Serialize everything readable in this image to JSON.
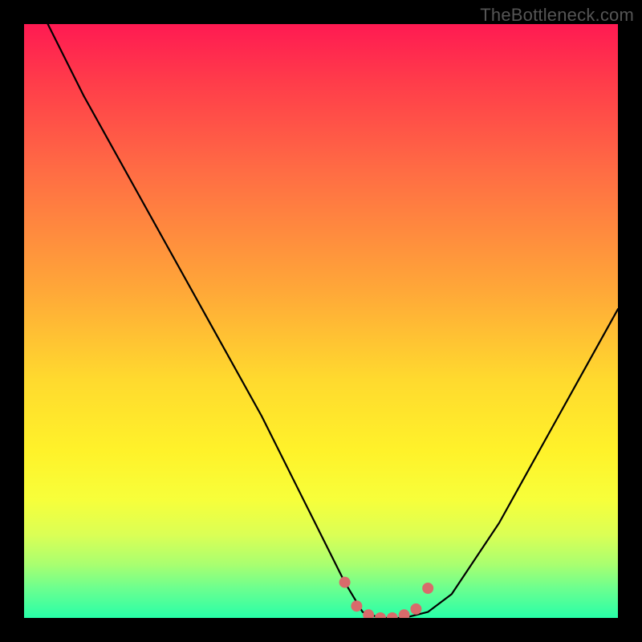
{
  "watermark": "TheBottleneck.com",
  "chart_data": {
    "type": "line",
    "title": "",
    "xlabel": "",
    "ylabel": "",
    "xlim": [
      0,
      100
    ],
    "ylim": [
      0,
      100
    ],
    "grid": false,
    "legend": false,
    "series": [
      {
        "name": "bottleneck-curve",
        "x": [
          4,
          10,
          20,
          30,
          40,
          48,
          54,
          57,
          60,
          64,
          68,
          72,
          80,
          90,
          100
        ],
        "y": [
          100,
          88,
          70,
          52,
          34,
          18,
          6,
          1,
          0,
          0,
          1,
          4,
          16,
          34,
          52
        ]
      },
      {
        "name": "highlight-dots",
        "x": [
          54,
          56,
          58,
          60,
          62,
          64,
          66,
          68
        ],
        "y": [
          6,
          2,
          0.5,
          0,
          0,
          0.5,
          1.5,
          5
        ]
      }
    ],
    "colors": {
      "curve": "#000000",
      "dots": "#d86b6b",
      "gradient_top": "#ff1a52",
      "gradient_bottom": "#28ffa8"
    }
  }
}
